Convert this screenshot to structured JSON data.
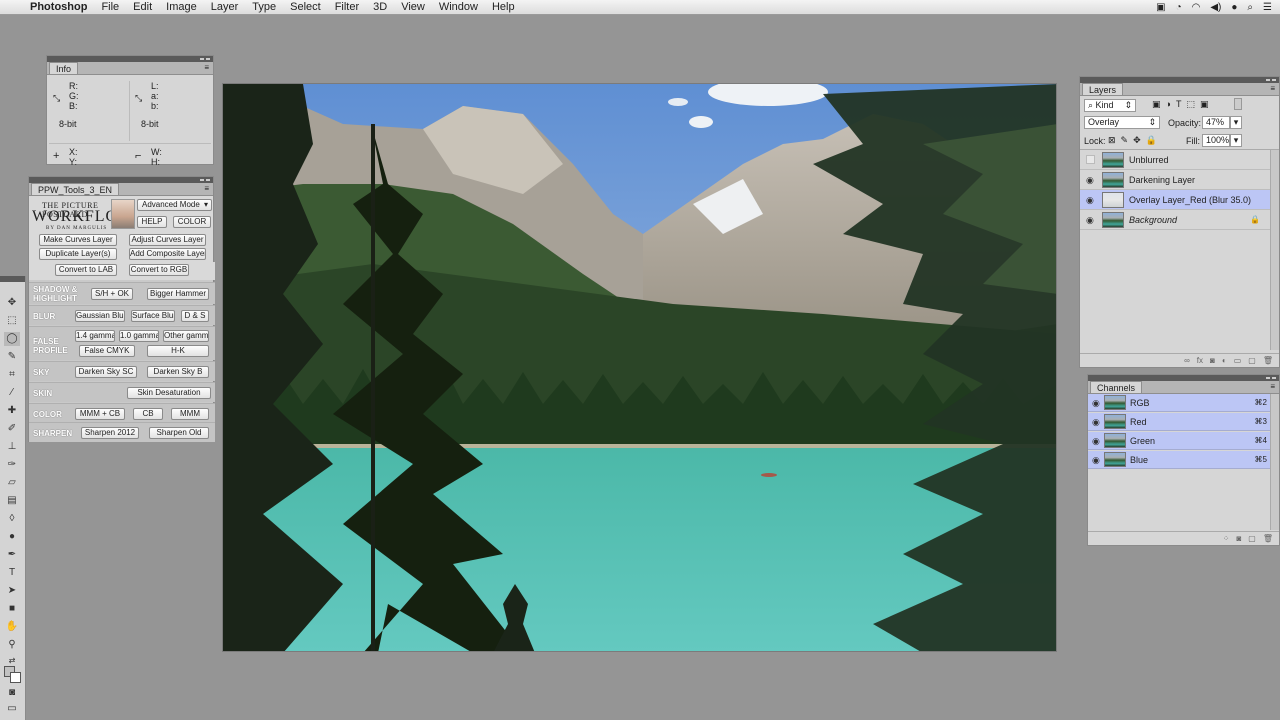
{
  "menubar": {
    "app": "Photoshop",
    "menus": [
      "File",
      "Edit",
      "Image",
      "Layer",
      "Type",
      "Select",
      "Filter",
      "3D",
      "View",
      "Window",
      "Help"
    ]
  },
  "info_panel": {
    "title": "Info",
    "rgb": [
      "R:",
      "G:",
      "B:"
    ],
    "lab": [
      "L:",
      "a:",
      "b:"
    ],
    "bit_left": "8-bit",
    "bit_right": "8-bit",
    "xy": [
      "X:",
      "Y:"
    ],
    "wh": [
      "W:",
      "H:"
    ]
  },
  "ppw": {
    "title": "PPW_Tools_3_EN",
    "logo_top": "THE PICTURE POSTCARD",
    "logo_main": "WORKFLOW",
    "logo_bottom": "BY DAN MARGULIS",
    "mode": "Advanced Mode",
    "help": "HELP",
    "color": "COLOR",
    "make_curves": "Make Curves Layer",
    "adjust_curves": "Adjust Curves Layer",
    "duplicate": "Duplicate Layer(s)",
    "add_composite": "Add Composite Layer",
    "to_lab": "Convert to LAB",
    "to_rgb": "Convert to RGB",
    "shadow_label": "SHADOW & HIGHLIGHT",
    "sh_ok": "S/H + OK",
    "bigger_hammer": "Bigger Hammer",
    "blur_label": "BLUR",
    "gaussian": "Gaussian Blur",
    "surface": "Surface Blur",
    "ds": "D & S",
    "false_label": "FALSE PROFILE",
    "g14": "1.4 gamma",
    "g10": "1.0 gamma",
    "gother": "Other gamma",
    "false_cmyk": "False CMYK",
    "hk": "H-K",
    "sky_label": "SKY",
    "darken_sc": "Darken Sky SC",
    "darken_b": "Darken Sky B",
    "skin_label": "SKIN",
    "skin_desat": "Skin Desaturation",
    "color_label": "COLOR",
    "mmm_cb": "MMM + CB",
    "cb": "CB",
    "mmm": "MMM",
    "sharpen_label": "SHARPEN",
    "sharpen2012": "Sharpen 2012",
    "sharpen_old": "Sharpen Old"
  },
  "layers": {
    "title": "Layers",
    "kind": "Kind",
    "blend_mode": "Overlay",
    "opacity_label": "Opacity:",
    "opacity_value": "47%",
    "lock_label": "Lock:",
    "fill_label": "Fill:",
    "fill_value": "100%",
    "items": [
      {
        "name": "Unblurred"
      },
      {
        "name": "Darkening Layer"
      },
      {
        "name": "Overlay Layer_Red (Blur 35.0)"
      },
      {
        "name": "Background"
      }
    ]
  },
  "channels": {
    "title": "Channels",
    "items": [
      {
        "name": "RGB",
        "key": "⌘2"
      },
      {
        "name": "Red",
        "key": "⌘3"
      },
      {
        "name": "Green",
        "key": "⌘4"
      },
      {
        "name": "Blue",
        "key": "⌘5"
      }
    ]
  }
}
